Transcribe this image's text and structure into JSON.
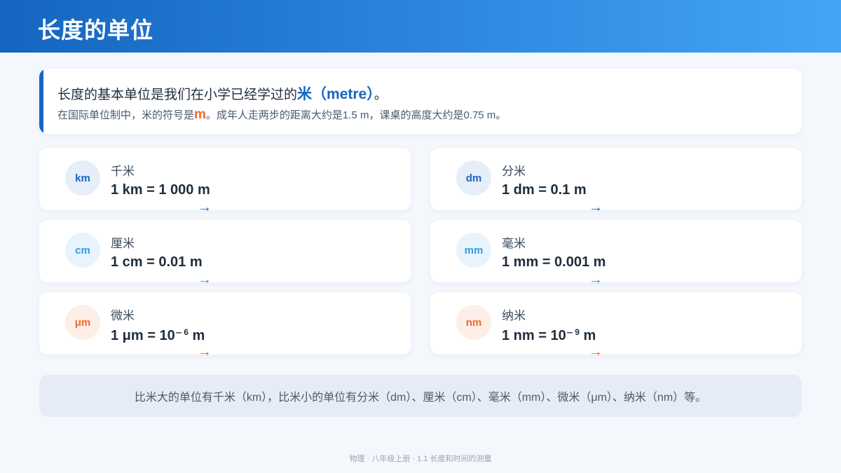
{
  "header": {
    "title": "长度的单位"
  },
  "intro": {
    "line1_prefix": "长度的基本单位是我们在小学已经学过的",
    "line1_highlight": "米（metre）",
    "line1_suffix": "。",
    "line2_prefix": "在国际单位制中，米的符号是",
    "line2_highlight": "m",
    "line2_suffix": "。成年人走两步的距离大约是1.5 m，课桌的高度大约是0.75 m。"
  },
  "units": [
    {
      "symbol": "km",
      "name": "千米",
      "eq": "1 km = 1 000 m",
      "exp": "",
      "eq_tail": "",
      "arrow": "→",
      "tone": "dark"
    },
    {
      "symbol": "dm",
      "name": "分米",
      "eq": "1 dm = 0.1 m",
      "exp": "",
      "eq_tail": "",
      "arrow": "→",
      "tone": "dark"
    },
    {
      "symbol": "cm",
      "name": "厘米",
      "eq": "1 cm = 0.01 m",
      "exp": "",
      "eq_tail": "",
      "arrow": "→",
      "tone": "light"
    },
    {
      "symbol": "mm",
      "name": "毫米",
      "eq": "1 mm = 0.001 m",
      "exp": "",
      "eq_tail": "",
      "arrow": "→",
      "tone": "light"
    },
    {
      "symbol": "μm",
      "name": "微米",
      "eq": "1 μm = 10⁻",
      "exp": "6",
      "eq_tail": " m",
      "arrow": "→",
      "tone": "orange"
    },
    {
      "symbol": "nm",
      "name": "纳米",
      "eq": "1 nm = 10⁻",
      "exp": "9",
      "eq_tail": " m",
      "arrow": "→",
      "tone": "orange"
    }
  ],
  "summary": "比米大的单位有千米（km），比米小的单位有分米（dm）、厘米（cm）、毫米（mm）、微米（μm）、纳米（nm）等。",
  "footer": "物理 · 八年级上册 · 1.1 长度和时间的测量",
  "colors": {
    "primary": "#1565c0",
    "light": "#2f9be0",
    "accent": "#f06a2a"
  }
}
